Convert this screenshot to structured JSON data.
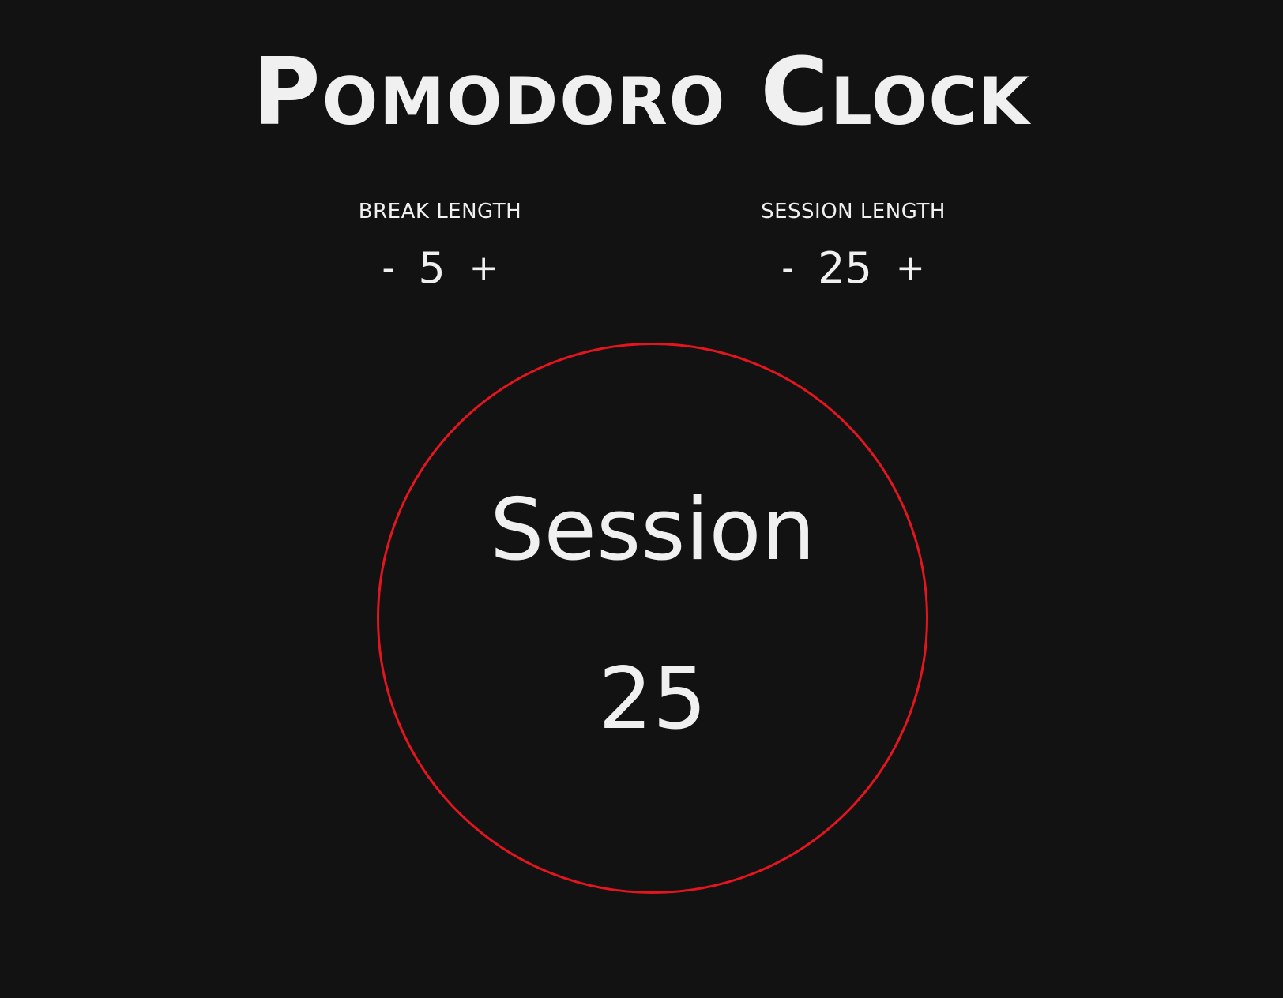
{
  "app": {
    "title": "Pomodoro Clock"
  },
  "break_control": {
    "label": "BREAK LENGTH",
    "decrement": "-",
    "value": "5",
    "increment": "+"
  },
  "session_control": {
    "label": "SESSION LENGTH",
    "decrement": "-",
    "value": "25",
    "increment": "+"
  },
  "clock": {
    "mode": "Session",
    "time": "25"
  },
  "colors": {
    "background": "#121212",
    "text": "#f0f0f0",
    "ring": "#e3151e"
  }
}
